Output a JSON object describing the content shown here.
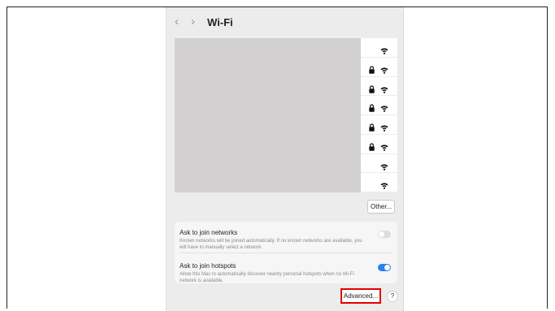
{
  "window": {
    "title": "Wi-Fi",
    "back_glyph": "‹",
    "forward_glyph": "›"
  },
  "networks": [
    {
      "locked": false,
      "icon": "wifi-icon"
    },
    {
      "locked": true,
      "icon": "wifi-icon"
    },
    {
      "locked": true,
      "icon": "wifi-icon"
    },
    {
      "locked": true,
      "icon": "wifi-icon"
    },
    {
      "locked": true,
      "icon": "wifi-icon"
    },
    {
      "locked": true,
      "icon": "wifi-icon"
    },
    {
      "locked": false,
      "icon": "wifi-icon"
    },
    {
      "locked": false,
      "icon": "wifi-icon"
    }
  ],
  "other_button": "Other...",
  "settings": {
    "ask_networks": {
      "label": "Ask to join networks",
      "description": "Known networks will be joined automatically. If no known networks are available, you will have to manually select a network.",
      "enabled": false
    },
    "ask_hotspots": {
      "label": "Ask to join hotspots",
      "description": "Allow this Mac to automatically discover nearby personal hotspots when no Wi-Fi network is available.",
      "enabled": true
    }
  },
  "advanced_button": "Advanced...",
  "help_button": "?",
  "colors": {
    "accent": "#2e7cf6",
    "highlight": "#e00000",
    "placeholder": "#d2d0d1"
  }
}
